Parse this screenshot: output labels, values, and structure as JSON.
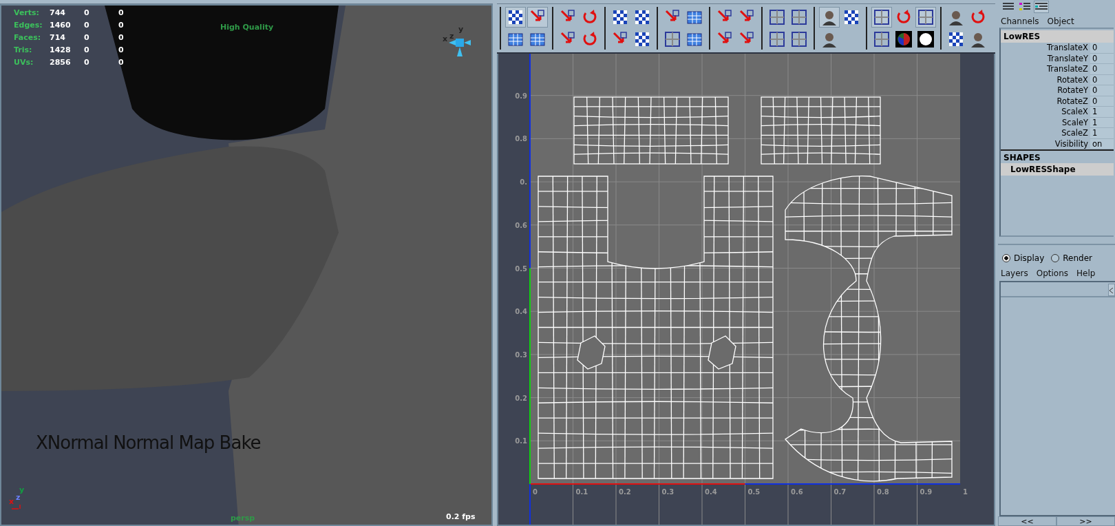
{
  "viewport": {
    "hud": [
      {
        "label": "Verts:",
        "values": [
          "744",
          "0",
          "0"
        ]
      },
      {
        "label": "Edges:",
        "values": [
          "1460",
          "0",
          "0"
        ]
      },
      {
        "label": "Faces:",
        "values": [
          "714",
          "0",
          "0"
        ]
      },
      {
        "label": "Tris:",
        "values": [
          "1428",
          "0",
          "0"
        ]
      },
      {
        "label": "UVs:",
        "values": [
          "2856",
          "0",
          "0"
        ]
      }
    ],
    "quality": "High Quality",
    "view_axes": [
      "y",
      "x",
      "z"
    ],
    "caption": "XNormal Normal Map Bake",
    "axes": [
      "y",
      "z",
      "x"
    ],
    "camera": "persp",
    "fps": "0.2 fps"
  },
  "uv_editor": {
    "toolbar": [
      [
        {
          "kind": "checker",
          "pressed": true
        },
        {
          "kind": "grid",
          "pressed": false
        },
        {
          "kind": "arrow",
          "pressed": true
        },
        {
          "kind": "grid",
          "pressed": false
        }
      ],
      [
        {
          "kind": "arrow",
          "pressed": false
        },
        {
          "kind": "arrow",
          "pressed": false
        },
        {
          "kind": "rotate",
          "pressed": false
        },
        {
          "kind": "rotate",
          "pressed": false
        }
      ],
      [
        {
          "kind": "checker",
          "pressed": false
        },
        {
          "kind": "arrow",
          "pressed": false
        },
        {
          "kind": "checker",
          "pressed": false
        },
        {
          "kind": "checker",
          "pressed": false
        }
      ],
      [
        {
          "kind": "arrow",
          "pressed": false
        },
        {
          "kind": "window",
          "pressed": false
        },
        {
          "kind": "grid",
          "pressed": false
        },
        {
          "kind": "grid",
          "pressed": false
        }
      ],
      [
        {
          "kind": "arrow",
          "pressed": false
        },
        {
          "kind": "arrow",
          "pressed": false
        },
        {
          "kind": "arrow",
          "pressed": false
        },
        {
          "kind": "arrow",
          "pressed": false
        }
      ],
      [
        {
          "kind": "window",
          "pressed": false
        },
        {
          "kind": "window",
          "pressed": false
        },
        {
          "kind": "window",
          "pressed": false
        },
        {
          "kind": "window",
          "pressed": false
        }
      ],
      [
        {
          "kind": "face",
          "pressed": true
        },
        {
          "kind": "face",
          "pressed": false
        },
        {
          "kind": "checker",
          "pressed": false
        }
      ],
      [
        {
          "kind": "window",
          "pressed": true
        },
        {
          "kind": "window",
          "pressed": false
        },
        {
          "kind": "rotate",
          "pressed": false
        },
        {
          "kind": "sphere",
          "pressed": false
        },
        {
          "kind": "window",
          "pressed": true
        },
        {
          "kind": "disc",
          "pressed": false
        }
      ],
      [
        {
          "kind": "face",
          "pressed": false
        },
        {
          "kind": "checker",
          "pressed": false
        },
        {
          "kind": "rotate",
          "pressed": false
        },
        {
          "kind": "face",
          "pressed": false
        }
      ]
    ],
    "v_labels": [
      "0.9",
      "0.8",
      "0.",
      "0.6",
      "0.5",
      "0.4",
      "0.3",
      "0.2",
      "0.1"
    ],
    "u_labels": [
      "0",
      "0.1",
      "0.2",
      "0.3",
      "0.4",
      "0.5",
      "0.6",
      "0.7",
      "0.8",
      "0.9",
      "1"
    ]
  },
  "channel_box": {
    "layout_buttons": [
      {
        "kind": "list",
        "selected": false
      },
      {
        "kind": "attrs",
        "selected": false
      },
      {
        "kind": "both",
        "selected": true
      }
    ],
    "menu": [
      "Channels",
      "Object"
    ],
    "object": "LowRES",
    "attributes": [
      {
        "name": "TranslateX",
        "value": "0"
      },
      {
        "name": "TranslateY",
        "value": "0"
      },
      {
        "name": "TranslateZ",
        "value": "0"
      },
      {
        "name": "RotateX",
        "value": "0"
      },
      {
        "name": "RotateY",
        "value": "0"
      },
      {
        "name": "RotateZ",
        "value": "0"
      },
      {
        "name": "ScaleX",
        "value": "1"
      },
      {
        "name": "ScaleY",
        "value": "1"
      },
      {
        "name": "ScaleZ",
        "value": "1"
      },
      {
        "name": "Visibility",
        "value": "on"
      }
    ],
    "shapes_header": "SHAPES",
    "shapes": [
      {
        "name": "LowRESShape",
        "selected": true
      }
    ]
  },
  "layer_editor": {
    "modes": [
      {
        "label": "Display",
        "selected": true
      },
      {
        "label": "Render",
        "selected": false
      }
    ],
    "menu": [
      "Layers",
      "Options",
      "Help"
    ],
    "nav": [
      "<<",
      ">>"
    ]
  }
}
